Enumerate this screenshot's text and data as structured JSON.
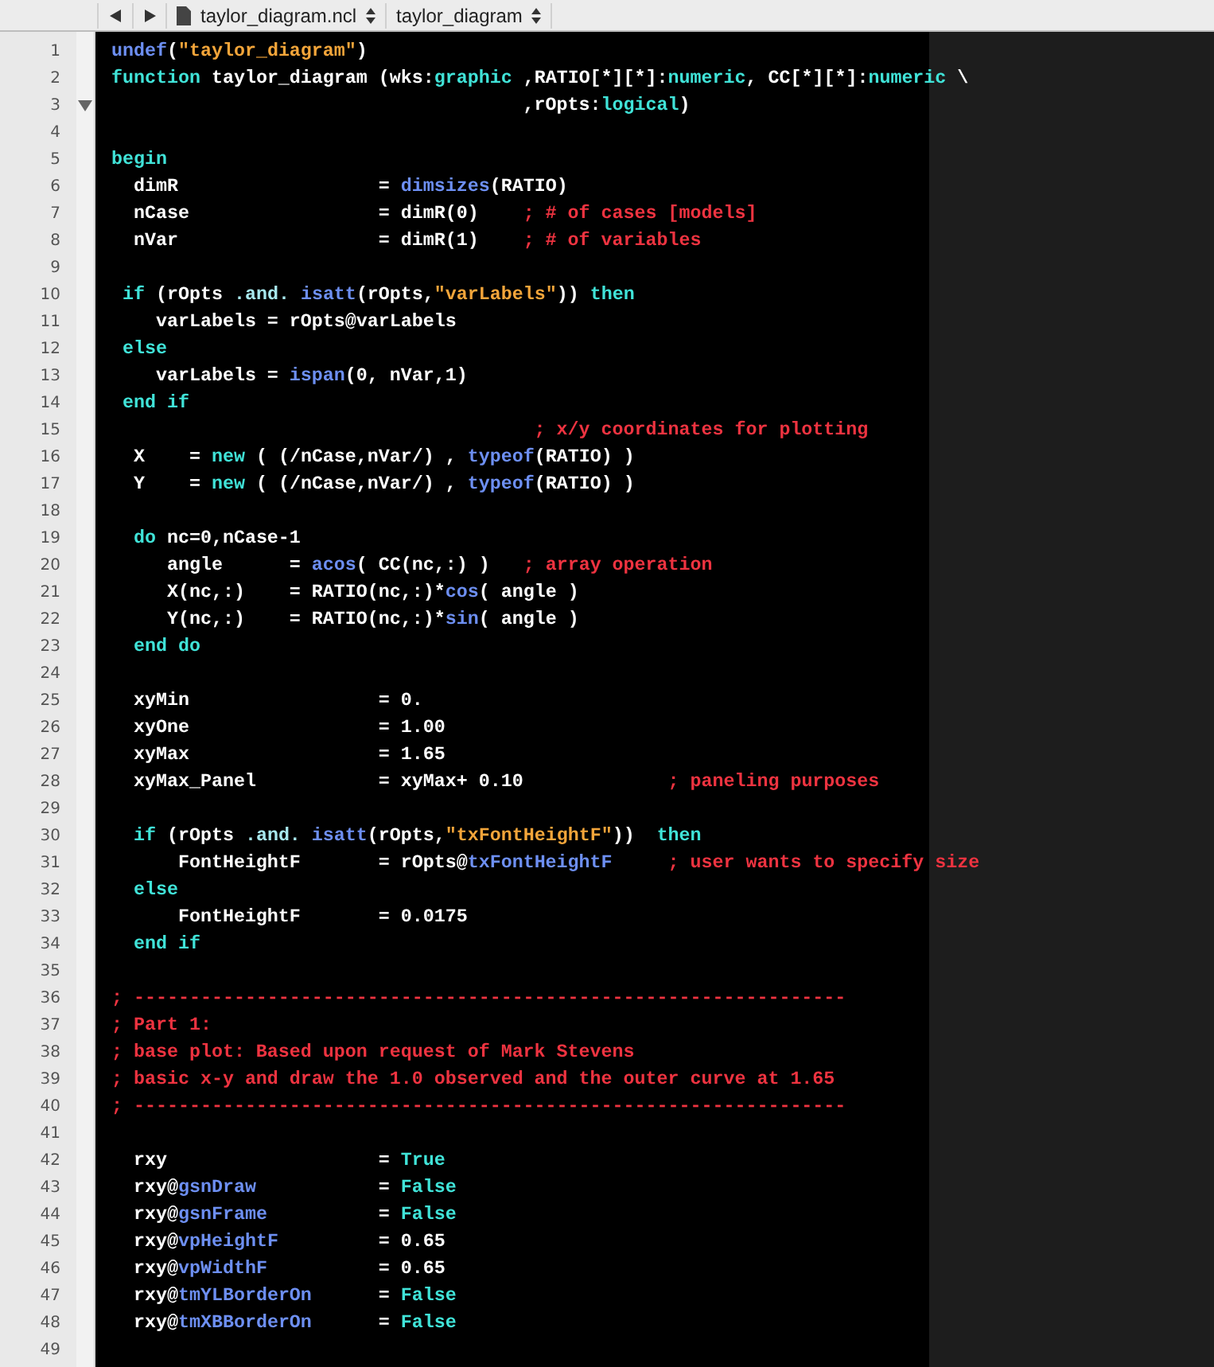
{
  "toolbar": {
    "file": "taylor_diagram.ncl",
    "symbol": "taylor_diagram"
  },
  "lines": [
    {
      "number": "1",
      "tokens": [
        {
          "kind": "builtin",
          "text": "undef"
        },
        {
          "kind": "plain",
          "text": "("
        },
        {
          "kind": "string",
          "text": "\"taylor_diagram\""
        },
        {
          "kind": "plain",
          "text": ")"
        }
      ]
    },
    {
      "number": "2",
      "tokens": [
        {
          "kind": "keyword",
          "text": "function"
        },
        {
          "kind": "plain",
          "text": " taylor_diagram (wks:"
        },
        {
          "kind": "keyword",
          "text": "graphic"
        },
        {
          "kind": "plain",
          "text": " ,RATIO[*][*]:"
        },
        {
          "kind": "keyword",
          "text": "numeric"
        },
        {
          "kind": "plain",
          "text": ", CC[*][*]:"
        },
        {
          "kind": "keyword",
          "text": "numeric"
        },
        {
          "kind": "plain",
          "text": " \\"
        }
      ]
    },
    {
      "number": "3",
      "fold": true,
      "tokens": [
        {
          "kind": "plain",
          "text": "                                     ,rOpts:"
        },
        {
          "kind": "keyword",
          "text": "logical"
        },
        {
          "kind": "plain",
          "text": ")"
        }
      ]
    },
    {
      "number": "4"
    },
    {
      "number": "5",
      "tokens": [
        {
          "kind": "keyword",
          "text": "begin"
        }
      ]
    },
    {
      "number": "6",
      "tokens": [
        {
          "kind": "plain",
          "text": "  dimR                  = "
        },
        {
          "kind": "builtin",
          "text": "dimsizes"
        },
        {
          "kind": "plain",
          "text": "(RATIO)"
        }
      ]
    },
    {
      "number": "7",
      "tokens": [
        {
          "kind": "plain",
          "text": "  nCase                 = dimR(0)    "
        },
        {
          "kind": "comment",
          "text": "; # of cases [models]"
        }
      ]
    },
    {
      "number": "8",
      "tokens": [
        {
          "kind": "plain",
          "text": "  nVar                  = dimR(1)    "
        },
        {
          "kind": "comment",
          "text": "; # of variables"
        }
      ]
    },
    {
      "number": "9"
    },
    {
      "number": "10",
      "tokens": [
        {
          "kind": "keyword",
          "text": " if"
        },
        {
          "kind": "plain",
          "text": " (rOpts "
        },
        {
          "kind": "operator",
          "text": ".and."
        },
        {
          "kind": "builtin",
          "text": " isatt"
        },
        {
          "kind": "plain",
          "text": "(rOpts,"
        },
        {
          "kind": "string",
          "text": "\"varLabels\""
        },
        {
          "kind": "plain",
          "text": ")) "
        },
        {
          "kind": "keyword",
          "text": "then"
        }
      ]
    },
    {
      "number": "11",
      "tokens": [
        {
          "kind": "plain",
          "text": "    varLabels = rOpts@varLabels"
        }
      ]
    },
    {
      "number": "12",
      "tokens": [
        {
          "kind": "keyword",
          "text": " else"
        }
      ]
    },
    {
      "number": "13",
      "tokens": [
        {
          "kind": "plain",
          "text": "    varLabels = "
        },
        {
          "kind": "builtin",
          "text": "ispan"
        },
        {
          "kind": "plain",
          "text": "(0, nVar,1)"
        }
      ]
    },
    {
      "number": "14",
      "tokens": [
        {
          "kind": "keyword",
          "text": " end if"
        }
      ]
    },
    {
      "number": "15",
      "tokens": [
        {
          "kind": "comment",
          "text": "                                      ; x/y coordinates for plotting"
        }
      ]
    },
    {
      "number": "16",
      "tokens": [
        {
          "kind": "plain",
          "text": "  X    = "
        },
        {
          "kind": "keyword",
          "text": "new"
        },
        {
          "kind": "plain",
          "text": " ( (/nCase,nVar/) , "
        },
        {
          "kind": "builtin",
          "text": "typeof"
        },
        {
          "kind": "plain",
          "text": "(RATIO) )"
        }
      ]
    },
    {
      "number": "17",
      "tokens": [
        {
          "kind": "plain",
          "text": "  Y    = "
        },
        {
          "kind": "keyword",
          "text": "new"
        },
        {
          "kind": "plain",
          "text": " ( (/nCase,nVar/) , "
        },
        {
          "kind": "builtin",
          "text": "typeof"
        },
        {
          "kind": "plain",
          "text": "(RATIO) )"
        }
      ]
    },
    {
      "number": "18"
    },
    {
      "number": "19",
      "tokens": [
        {
          "kind": "keyword",
          "text": "  do"
        },
        {
          "kind": "plain",
          "text": " nc=0,nCase-1"
        }
      ]
    },
    {
      "number": "20",
      "tokens": [
        {
          "kind": "plain",
          "text": "     angle      = "
        },
        {
          "kind": "builtin",
          "text": "acos"
        },
        {
          "kind": "plain",
          "text": "( CC(nc,:) )   "
        },
        {
          "kind": "comment",
          "text": "; array operation"
        }
      ]
    },
    {
      "number": "21",
      "tokens": [
        {
          "kind": "plain",
          "text": "     X(nc,:)    = RATIO(nc,:)*"
        },
        {
          "kind": "builtin",
          "text": "cos"
        },
        {
          "kind": "plain",
          "text": "( angle )"
        }
      ]
    },
    {
      "number": "22",
      "tokens": [
        {
          "kind": "plain",
          "text": "     Y(nc,:)    = RATIO(nc,:)*"
        },
        {
          "kind": "builtin",
          "text": "sin"
        },
        {
          "kind": "plain",
          "text": "( angle )"
        }
      ]
    },
    {
      "number": "23",
      "tokens": [
        {
          "kind": "keyword",
          "text": "  end do"
        }
      ]
    },
    {
      "number": "24"
    },
    {
      "number": "25",
      "tokens": [
        {
          "kind": "plain",
          "text": "  xyMin                 = 0."
        }
      ]
    },
    {
      "number": "26",
      "tokens": [
        {
          "kind": "plain",
          "text": "  xyOne                 = 1.00"
        }
      ]
    },
    {
      "number": "27",
      "tokens": [
        {
          "kind": "plain",
          "text": "  xyMax                 = 1.65"
        }
      ]
    },
    {
      "number": "28",
      "tokens": [
        {
          "kind": "plain",
          "text": "  xyMax_Panel           = xyMax+ 0.10             "
        },
        {
          "kind": "comment",
          "text": "; paneling purposes"
        }
      ]
    },
    {
      "number": "29"
    },
    {
      "number": "30",
      "tokens": [
        {
          "kind": "keyword",
          "text": "  if"
        },
        {
          "kind": "plain",
          "text": " (rOpts "
        },
        {
          "kind": "operator",
          "text": ".and."
        },
        {
          "kind": "builtin",
          "text": " isatt"
        },
        {
          "kind": "plain",
          "text": "(rOpts,"
        },
        {
          "kind": "string",
          "text": "\"txFontHeightF\""
        },
        {
          "kind": "plain",
          "text": "))  "
        },
        {
          "kind": "keyword",
          "text": "then"
        }
      ]
    },
    {
      "number": "31",
      "tokens": [
        {
          "kind": "plain",
          "text": "      FontHeightF       = rOpts@"
        },
        {
          "kind": "attribute",
          "text": "txFontHeightF"
        },
        {
          "kind": "comment",
          "text": "     ; user wants to specify size"
        }
      ]
    },
    {
      "number": "32",
      "tokens": [
        {
          "kind": "keyword",
          "text": "  else"
        }
      ]
    },
    {
      "number": "33",
      "tokens": [
        {
          "kind": "plain",
          "text": "      FontHeightF       = 0.0175"
        }
      ]
    },
    {
      "number": "34",
      "tokens": [
        {
          "kind": "keyword",
          "text": "  end if"
        }
      ]
    },
    {
      "number": "35"
    },
    {
      "number": "36",
      "tokens": [
        {
          "kind": "comment",
          "text": "; ----------------------------------------------------------------"
        }
      ]
    },
    {
      "number": "37",
      "tokens": [
        {
          "kind": "comment",
          "text": "; Part 1:"
        }
      ]
    },
    {
      "number": "38",
      "tokens": [
        {
          "kind": "comment",
          "text": "; base plot: Based upon request of Mark Stevens"
        }
      ]
    },
    {
      "number": "39",
      "tokens": [
        {
          "kind": "comment",
          "text": "; basic x-y and draw the 1.0 observed and the outer curve at 1.65"
        }
      ]
    },
    {
      "number": "40",
      "tokens": [
        {
          "kind": "comment",
          "text": "; ----------------------------------------------------------------"
        }
      ]
    },
    {
      "number": "41"
    },
    {
      "number": "42",
      "tokens": [
        {
          "kind": "plain",
          "text": "  rxy                   = "
        },
        {
          "kind": "keyword",
          "text": "True"
        }
      ]
    },
    {
      "number": "43",
      "tokens": [
        {
          "kind": "plain",
          "text": "  rxy@"
        },
        {
          "kind": "attribute",
          "text": "gsnDraw"
        },
        {
          "kind": "plain",
          "text": "           = "
        },
        {
          "kind": "keyword",
          "text": "False"
        }
      ]
    },
    {
      "number": "44",
      "tokens": [
        {
          "kind": "plain",
          "text": "  rxy@"
        },
        {
          "kind": "attribute",
          "text": "gsnFrame"
        },
        {
          "kind": "plain",
          "text": "          = "
        },
        {
          "kind": "keyword",
          "text": "False"
        }
      ]
    },
    {
      "number": "45",
      "tokens": [
        {
          "kind": "plain",
          "text": "  rxy@"
        },
        {
          "kind": "attribute",
          "text": "vpHeightF"
        },
        {
          "kind": "plain",
          "text": "         = 0.65"
        }
      ]
    },
    {
      "number": "46",
      "tokens": [
        {
          "kind": "plain",
          "text": "  rxy@"
        },
        {
          "kind": "attribute",
          "text": "vpWidthF"
        },
        {
          "kind": "plain",
          "text": "          = 0.65"
        }
      ]
    },
    {
      "number": "47",
      "tokens": [
        {
          "kind": "plain",
          "text": "  rxy@"
        },
        {
          "kind": "attribute",
          "text": "tmYLBorderOn"
        },
        {
          "kind": "plain",
          "text": "      = "
        },
        {
          "kind": "keyword",
          "text": "False"
        }
      ]
    },
    {
      "number": "48",
      "tokens": [
        {
          "kind": "plain",
          "text": "  rxy@"
        },
        {
          "kind": "attribute",
          "text": "tmXBBorderOn"
        },
        {
          "kind": "plain",
          "text": "      = "
        },
        {
          "kind": "keyword",
          "text": "False"
        }
      ]
    },
    {
      "number": "49"
    }
  ]
}
